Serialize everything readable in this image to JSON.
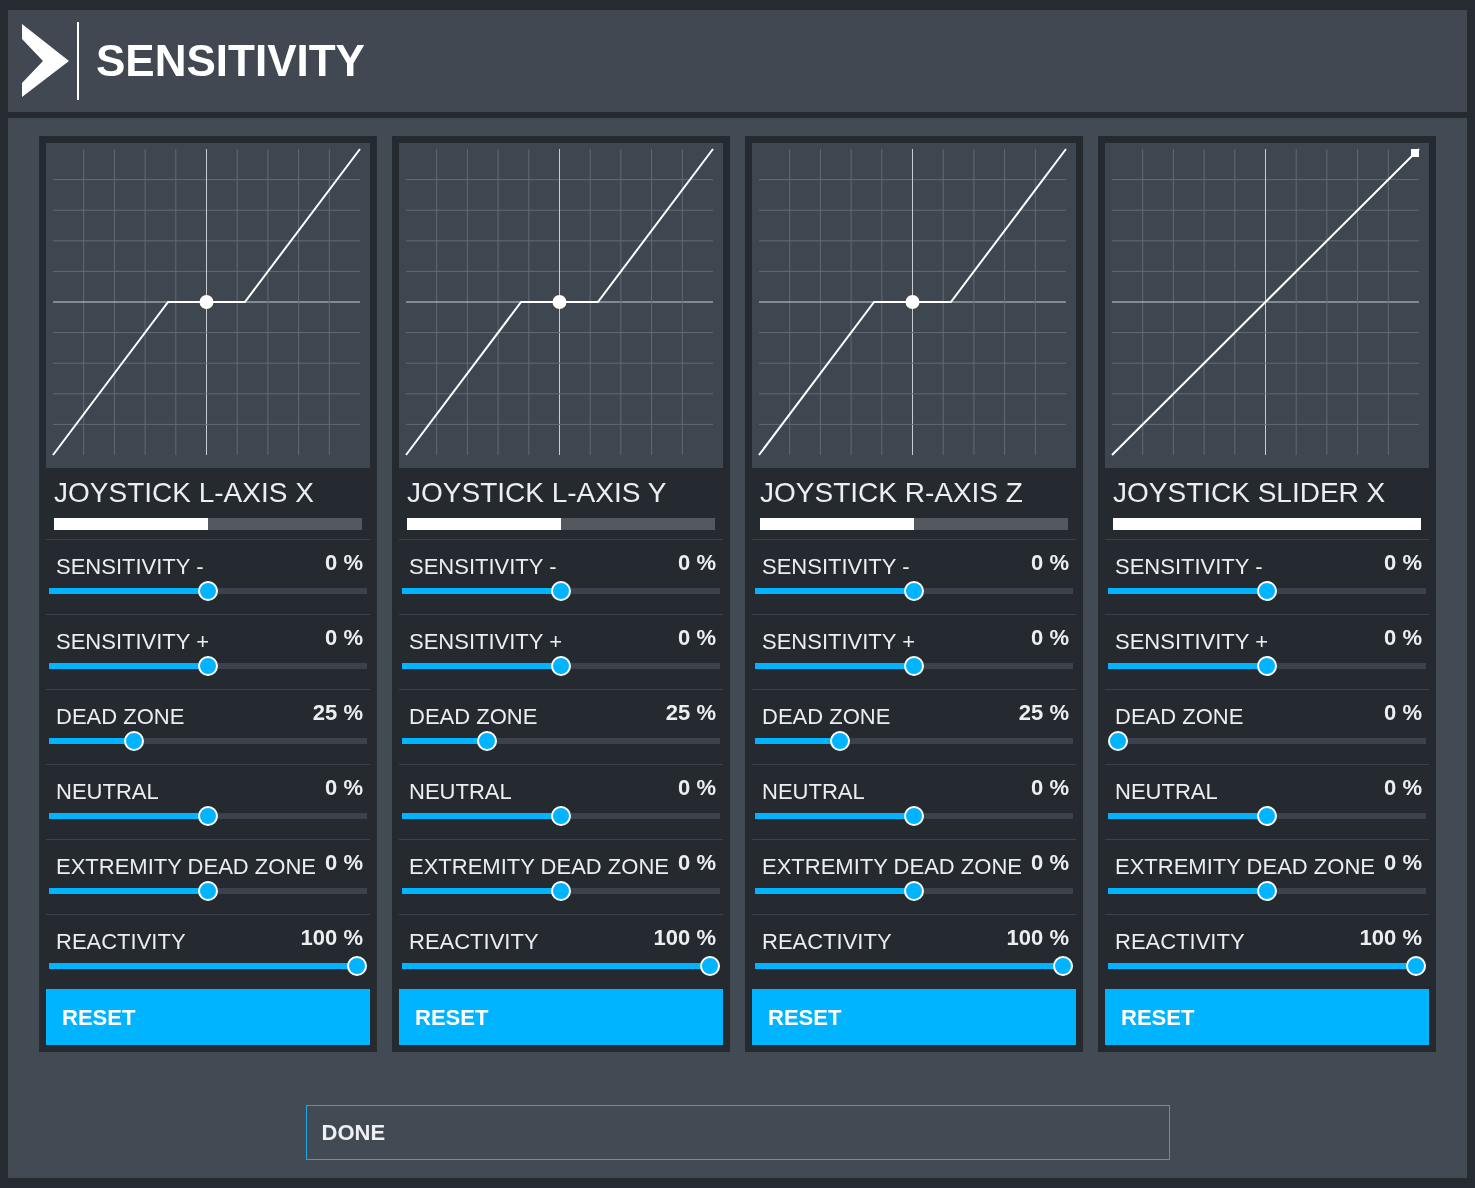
{
  "header": {
    "title": "SENSITIVITY"
  },
  "axes": [
    {
      "name": "JOYSTICK L-AXIS X",
      "input": {
        "level": 0.5
      },
      "settings": [
        {
          "label": "SENSITIVITY -",
          "value": "0 %",
          "level": 0.5
        },
        {
          "label": "SENSITIVITY +",
          "value": "0 %",
          "level": 0.5
        },
        {
          "label": "DEAD ZONE",
          "value": "25 %",
          "level": 0.25
        },
        {
          "label": "NEUTRAL",
          "value": "0 %",
          "level": 0.5
        },
        {
          "label": "EXTREMITY DEAD ZONE",
          "value": "0 %",
          "level": 0.5
        },
        {
          "label": "REACTIVITY",
          "value": "100 %",
          "level": 1
        }
      ],
      "reset_button": "RESET"
    },
    {
      "name": "JOYSTICK L-AXIS Y",
      "input": {
        "level": 0.5
      },
      "settings": [
        {
          "label": "SENSITIVITY -",
          "value": "0 %",
          "level": 0.5
        },
        {
          "label": "SENSITIVITY +",
          "value": "0 %",
          "level": 0.5
        },
        {
          "label": "DEAD ZONE",
          "value": "25 %",
          "level": 0.25
        },
        {
          "label": "NEUTRAL",
          "value": "0 %",
          "level": 0.5
        },
        {
          "label": "EXTREMITY DEAD ZONE",
          "value": "0 %",
          "level": 0.5
        },
        {
          "label": "REACTIVITY",
          "value": "100 %",
          "level": 1
        }
      ],
      "reset_button": "RESET"
    },
    {
      "name": "JOYSTICK R-AXIS Z",
      "input": {
        "level": 0.5
      },
      "settings": [
        {
          "label": "SENSITIVITY -",
          "value": "0 %",
          "level": 0.5
        },
        {
          "label": "SENSITIVITY +",
          "value": "0 %",
          "level": 0.5
        },
        {
          "label": "DEAD ZONE",
          "value": "25 %",
          "level": 0.25
        },
        {
          "label": "NEUTRAL",
          "value": "0 %",
          "level": 0.5
        },
        {
          "label": "EXTREMITY DEAD ZONE",
          "value": "0 %",
          "level": 0.5
        },
        {
          "label": "REACTIVITY",
          "value": "100 %",
          "level": 1
        }
      ],
      "reset_button": "RESET"
    },
    {
      "name": "JOYSTICK SLIDER X",
      "input": {
        "level": 1
      },
      "settings": [
        {
          "label": "SENSITIVITY -",
          "value": "0 %",
          "level": 0.5
        },
        {
          "label": "SENSITIVITY +",
          "value": "0 %",
          "level": 0.5
        },
        {
          "label": "DEAD ZONE",
          "value": "0 %",
          "level": 0
        },
        {
          "label": "NEUTRAL",
          "value": "0 %",
          "level": 0.5
        },
        {
          "label": "EXTREMITY DEAD ZONE",
          "value": "0 %",
          "level": 0.5
        },
        {
          "label": "REACTIVITY",
          "value": "100 %",
          "level": 1
        }
      ],
      "reset_button": "RESET"
    }
  ],
  "done_button": "DONE"
}
